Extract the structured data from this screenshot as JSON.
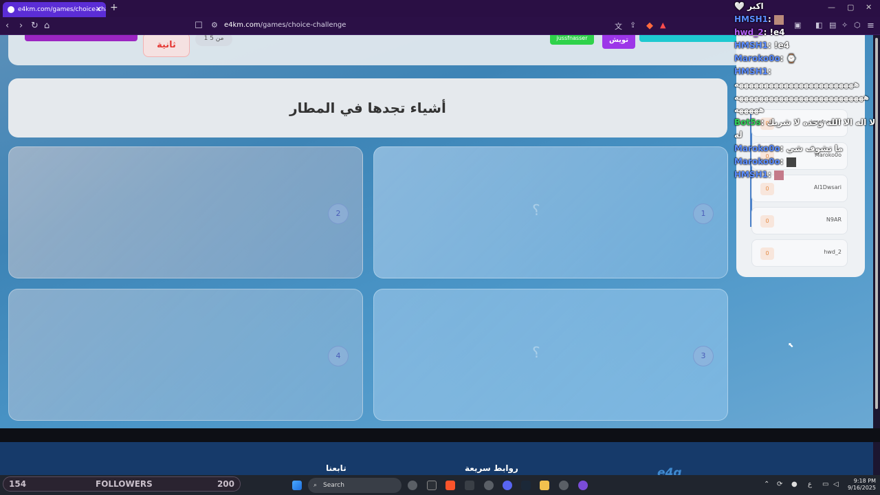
{
  "browser": {
    "tab_title": "e4km.com/games/choice-challe",
    "tab_close": "✕",
    "new_tab": "+",
    "url_host": "e4km.com",
    "url_path": "/games/choice-challenge",
    "win_minimize": "—",
    "win_maximize": "▢",
    "win_close": "✕"
  },
  "game": {
    "second_label": "ثانية",
    "pager": "1 من 5",
    "player_chip": "jussfnasser",
    "tweish_button": "تويش",
    "question": "أشياء تجدها في المطار",
    "options": [
      {
        "num": "1",
        "mark": "؟"
      },
      {
        "num": "2",
        "mark": ""
      },
      {
        "num": "3",
        "mark": "؟"
      },
      {
        "num": "4",
        "mark": ""
      }
    ]
  },
  "players": [
    {
      "score": "0",
      "name": "jussfnasser"
    },
    {
      "score": "0",
      "name": "Maroko0o"
    },
    {
      "score": "0",
      "name": "Al1Dwsari"
    },
    {
      "score": "0",
      "name": "N9AR"
    },
    {
      "score": "0",
      "name": "hwd_2"
    }
  ],
  "chat": {
    "lines": [
      {
        "user": "",
        "text": "🤍 اكبر",
        "color": "#ffffff"
      },
      {
        "user": "HMSH1",
        "text": ":",
        "color": "#5b8dff"
      },
      {
        "user": "hwd_2",
        "text": ": !e4",
        "color": "#b25cf5"
      },
      {
        "user": "HMSH1",
        "text": ": !e4",
        "color": "#5b8dff"
      },
      {
        "user": "Maroko0o",
        "text": ": ⌚",
        "color": "#5b8dff"
      },
      {
        "user": "HMSH1",
        "text": ":",
        "color": "#5b8dff"
      },
      {
        "user": "",
        "text": "ههههههههههههههههههههههههه",
        "color": "#ffffff"
      },
      {
        "user": "",
        "text": "ههههههههههههههههههههههههههه",
        "color": "#ffffff"
      },
      {
        "user": "",
        "text": "هههههه",
        "color": "#ffffff"
      },
      {
        "user": "Bot5s",
        "text": ": لا اله الا الله وحده لا شريك",
        "color": "#32d25a"
      },
      {
        "user": "",
        "text": "له",
        "color": "#ffffff"
      },
      {
        "user": "Maroko0o",
        "text": ": ما تشوف شي",
        "color": "#5b8dff"
      },
      {
        "user": "Maroko0o",
        "text": ":",
        "color": "#5b8dff"
      },
      {
        "user": "HMSH1",
        "text": ":",
        "color": "#5b8dff"
      }
    ]
  },
  "footer": {
    "follow_title": "تابعنا",
    "links_title": "روابط سريعة",
    "logo": "e4g"
  },
  "followers_bar": {
    "current": "154",
    "label": "FOLLOWERS",
    "goal": "200"
  },
  "taskbar": {
    "search_label": "Search",
    "time": "9:18 PM",
    "date": "9/16/2025",
    "lang": "ع"
  }
}
